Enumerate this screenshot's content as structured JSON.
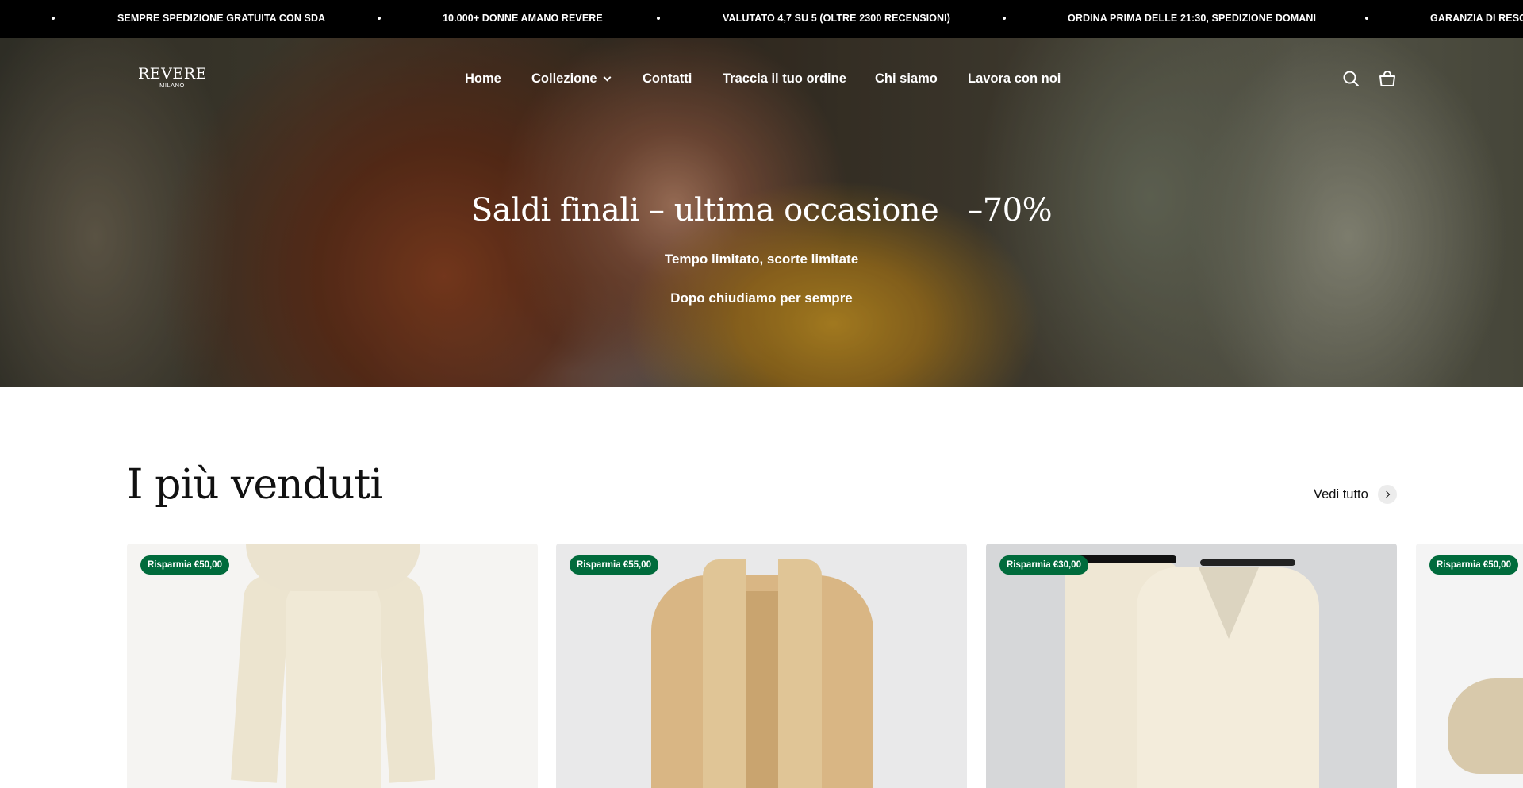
{
  "announcement": {
    "items": [
      "SEMPRE SPEDIZIONE GRATUITA CON SDA",
      "10.000+ DONNE AMANO REVERE",
      "VALUTATO 4,7 SU 5 (OLTRE 2300 RECENSIONI)",
      "ORDINA PRIMA DELLE 21:30, SPEDIZIONE DOMANI",
      "GARANZIA DI RESO"
    ]
  },
  "header": {
    "logo": {
      "brand": "REVERE",
      "sub": "MILANO"
    },
    "nav": [
      {
        "label": "Home"
      },
      {
        "label": "Collezione",
        "has_dropdown": true
      },
      {
        "label": "Contatti"
      },
      {
        "label": "Traccia il tuo ordine"
      },
      {
        "label": "Chi siamo"
      },
      {
        "label": "Lavora con noi"
      }
    ],
    "icons": [
      "search-icon",
      "cart-icon"
    ]
  },
  "hero": {
    "title": "Saldi finali – ultima occasione",
    "discount": "–70%",
    "line1": "Tempo limitato, scorte limitate",
    "line2": "Dopo chiudiamo per sempre"
  },
  "bestsellers": {
    "title": "I più venduti",
    "view_all": "Vedi tutto",
    "products": [
      {
        "badge": "Risparmia €50,00"
      },
      {
        "badge": "Risparmia €55,00"
      },
      {
        "badge": "Risparmia €30,00"
      },
      {
        "badge": "Risparmia €50,00"
      }
    ]
  },
  "colors": {
    "announcement_bg": "#000000",
    "badge_bg": "#006b3c",
    "text": "#111111"
  }
}
